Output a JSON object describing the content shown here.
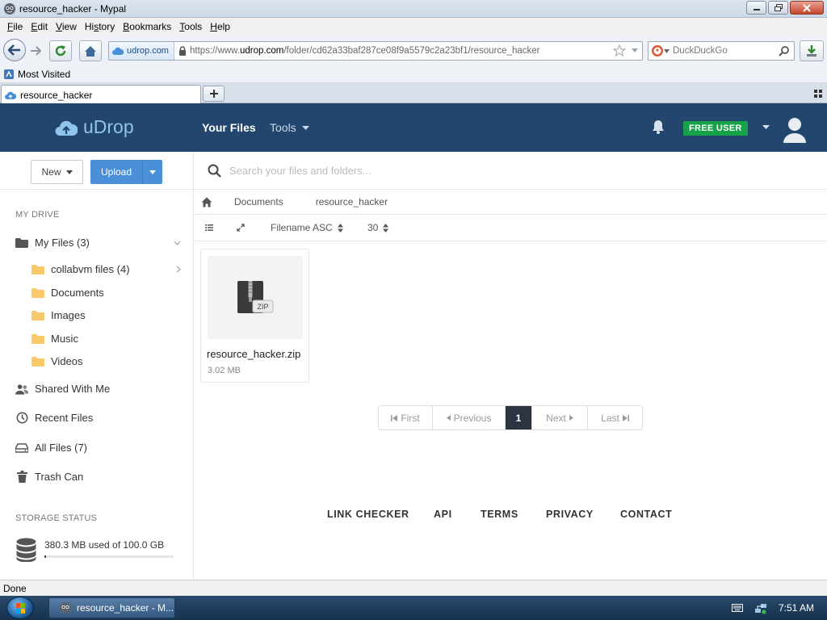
{
  "browser": {
    "window_title": "resource_hacker - Mypal",
    "menu": [
      {
        "pre": "",
        "key": "F",
        "post": "ile"
      },
      {
        "pre": "",
        "key": "E",
        "post": "dit"
      },
      {
        "pre": "",
        "key": "V",
        "post": "iew"
      },
      {
        "pre": "Hi",
        "key": "s",
        "post": "tory"
      },
      {
        "pre": "",
        "key": "B",
        "post": "ookmarks"
      },
      {
        "pre": "",
        "key": "T",
        "post": "ools"
      },
      {
        "pre": "",
        "key": "H",
        "post": "elp"
      }
    ],
    "identity_label": "udrop.com",
    "url_prefix": "https://www.",
    "url_domain": "udrop.com",
    "url_path": "/folder/cd62a33baf287ce08f9a5579c2a23bf1/resource_hacker",
    "search_engine": "DuckDuckGo",
    "bookmark": "Most Visited",
    "tab_title": "resource_hacker",
    "status": "Done"
  },
  "site": {
    "logo": "uDrop",
    "nav_your_files": "Your Files",
    "nav_tools": "Tools",
    "account_badge": "FREE USER",
    "colors": {
      "header": "#23466e",
      "accent": "#4a90d9",
      "badge": "#17a24a"
    }
  },
  "sidebar": {
    "new_label": "New",
    "upload_label": "Upload",
    "my_drive": "MY DRIVE",
    "my_files": "My Files (3)",
    "folders": [
      "collabvm files (4)",
      "Documents",
      "Images",
      "Music",
      "Videos"
    ],
    "shared": "Shared With Me",
    "recent": "Recent Files",
    "all_files": "All Files (7)",
    "trash": "Trash Can",
    "storage_title": "STORAGE STATUS",
    "storage_text": "380.3 MB used of 100.0 GB",
    "storage_used_fraction": 0.0038
  },
  "main": {
    "search_placeholder": "Search your files and folders...",
    "breadcrumb": [
      "Documents",
      "resource_hacker"
    ],
    "sort_label": "Filename ASC",
    "per_page": "30",
    "files": [
      {
        "name": "resource_hacker.zip",
        "size": "3.02 MB",
        "type_badge": "ZIP"
      }
    ],
    "pager": {
      "first": "First",
      "previous": "Previous",
      "current": "1",
      "next": "Next",
      "last": "Last"
    },
    "footer": [
      "LINK CHECKER",
      "API",
      "TERMS",
      "PRIVACY",
      "CONTACT"
    ]
  },
  "taskbar": {
    "task_label": "resource_hacker - M...",
    "clock": "7:51 AM"
  }
}
